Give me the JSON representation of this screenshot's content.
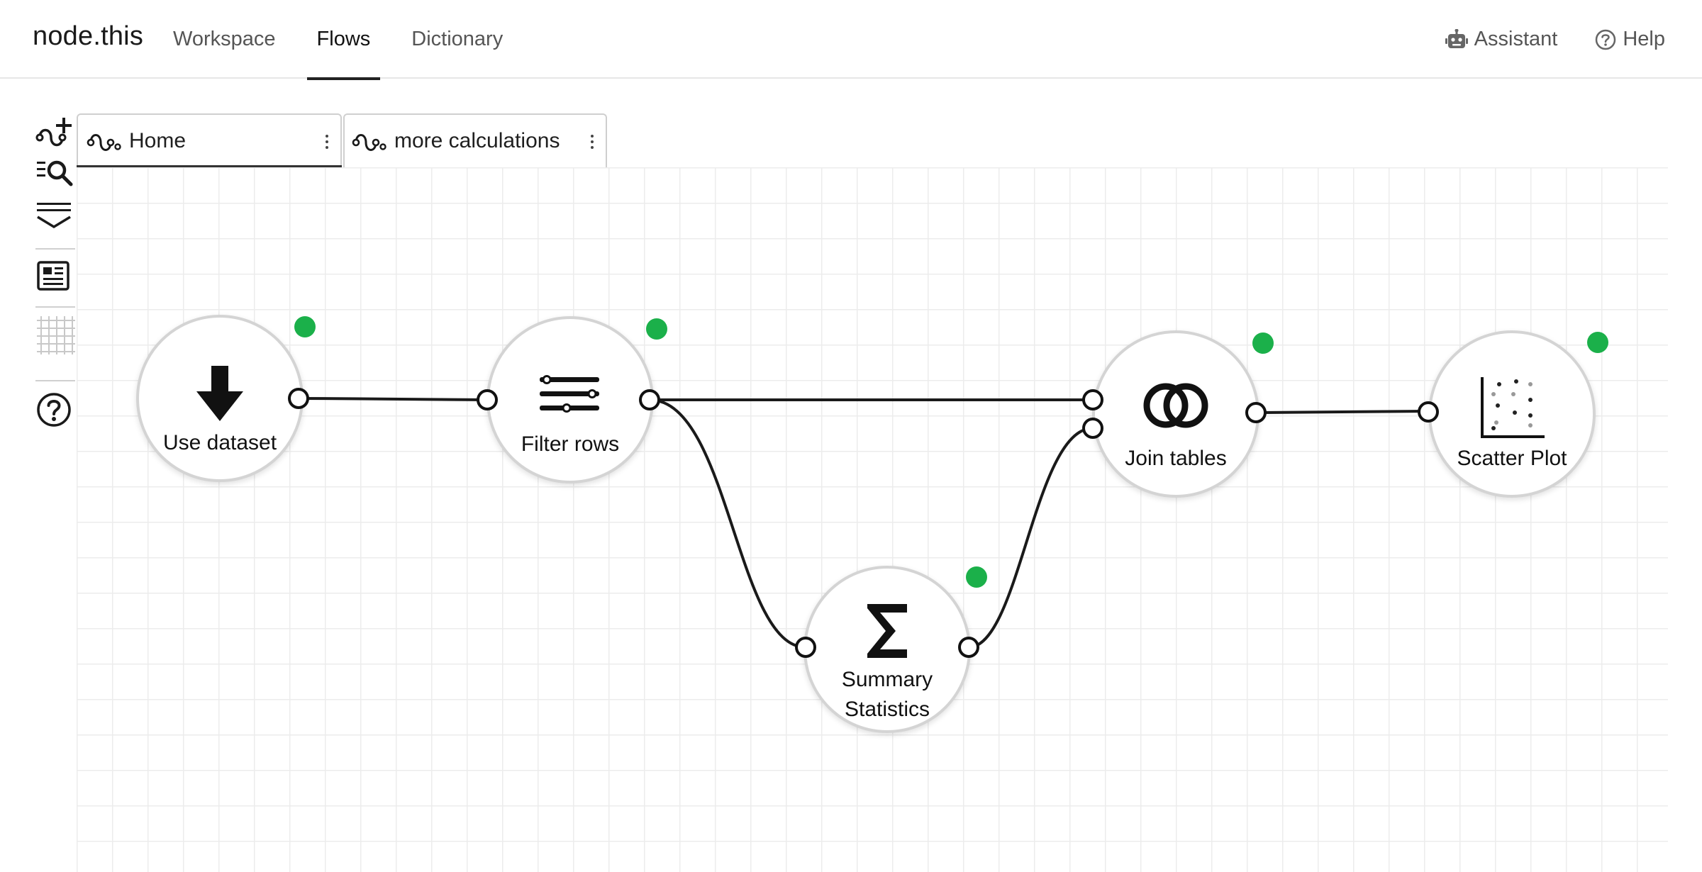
{
  "app": {
    "brand": "node.this",
    "nav": [
      "Workspace",
      "Flows",
      "Dictionary"
    ],
    "active_nav": "Flows",
    "assistant_label": "Assistant",
    "help_label": "Help"
  },
  "tabs": [
    {
      "label": "Home",
      "active": true
    },
    {
      "label": "more calculations",
      "active": false
    }
  ],
  "toolbar": {
    "icons": [
      "add-flow-icon",
      "search-nodes-icon",
      "collapse-icon",
      "report-icon",
      "grid-icon",
      "help-circle-icon"
    ]
  },
  "colors": {
    "status_ok": "#1bb04a",
    "edge": "#1a1a1a",
    "node_border": "#d4d4d4"
  },
  "nodes": [
    {
      "id": "use-dataset",
      "label": "Use dataset",
      "icon": "download-arrow-icon",
      "status": "ok"
    },
    {
      "id": "filter-rows",
      "label": "Filter rows",
      "icon": "filter-sliders-icon",
      "status": "ok"
    },
    {
      "id": "join-tables",
      "label": "Join tables",
      "icon": "join-rings-icon",
      "status": "ok"
    },
    {
      "id": "scatter-plot",
      "label": "Scatter Plot",
      "icon": "scatter-plot-icon",
      "status": "ok"
    },
    {
      "id": "summary-statistics",
      "label_line1": "Summary",
      "label_line2": "Statistics",
      "icon": "sigma-icon",
      "status": "ok"
    }
  ]
}
